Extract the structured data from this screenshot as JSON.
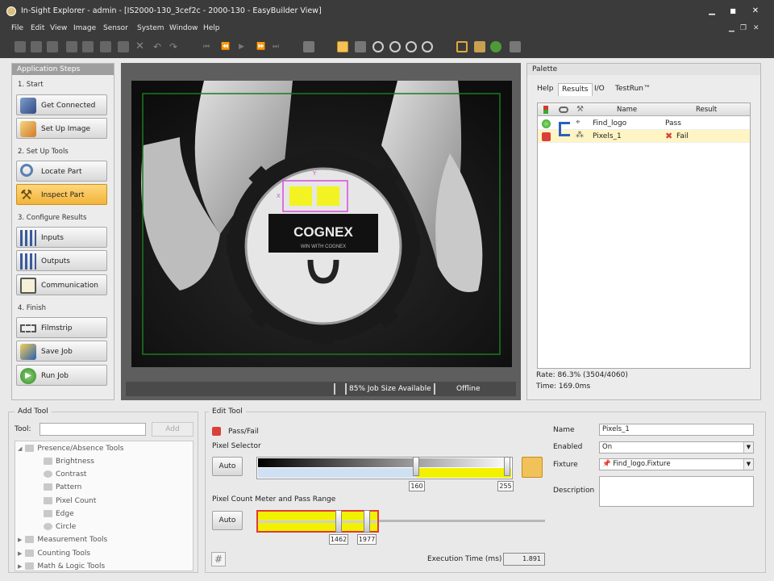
{
  "window": {
    "title": "In-Sight Explorer - admin - [IS2000-130_3cef2c - 2000-130 - EasyBuilder View]",
    "minimize": "▁",
    "maximize": "■",
    "close": "✕",
    "mdi_min": "▁",
    "mdi_restore": "❐",
    "mdi_close": "✕"
  },
  "menu": [
    "File",
    "Edit",
    "View",
    "Image",
    "Sensor",
    "System",
    "Window",
    "Help"
  ],
  "toolbar_icons": [
    "new-icon",
    "open-icon",
    "save-icon",
    "print-icon",
    "copy-icon",
    "paste-icon",
    "delete-icon",
    "undo-icon",
    "redo-icon",
    "first-icon",
    "prev-icon",
    "play-icon",
    "next-icon",
    "last-icon",
    "record-icon",
    "stop-icon",
    "circle-icon",
    "live-icon",
    "acquire-icon",
    "zoom-in-icon",
    "zoom-out-icon",
    "zoom-fit-icon",
    "zoom-100-icon",
    "zoom-active-icon",
    "fixture-icon",
    "graphics-icon",
    "settings-icon",
    "online-icon"
  ],
  "app_steps": {
    "header": "Application Steps",
    "sections": [
      {
        "title": "1. Start",
        "items": [
          {
            "label": "Get Connected",
            "icon": "camera-icon"
          },
          {
            "label": "Set Up Image",
            "icon": "image-setup-icon"
          }
        ]
      },
      {
        "title": "2. Set Up Tools",
        "items": [
          {
            "label": "Locate Part",
            "icon": "magnifier-icon"
          },
          {
            "label": "Inspect Part",
            "icon": "tools-icon",
            "active": true
          }
        ]
      },
      {
        "title": "3. Configure Results",
        "items": [
          {
            "label": "Inputs",
            "icon": "inputs-icon"
          },
          {
            "label": "Outputs",
            "icon": "outputs-icon"
          },
          {
            "label": "Communication",
            "icon": "communication-icon"
          }
        ]
      },
      {
        "title": "4. Finish",
        "items": [
          {
            "label": "Filmstrip",
            "icon": "filmstrip-icon"
          },
          {
            "label": "Save Job",
            "icon": "save-job-icon"
          },
          {
            "label": "Run Job",
            "icon": "run-icon"
          }
        ]
      }
    ]
  },
  "image_view": {
    "status": {
      "job_size": "85% Job Size Available",
      "mode": "Offline"
    },
    "logo_text": "COGNEX",
    "logo_sub": "WIN WITH COGNEX",
    "roi_x": "X",
    "roi_y": "Y"
  },
  "palette": {
    "header": "Palette",
    "tabs": [
      "Help",
      "Results",
      "I/O",
      "TestRun™"
    ],
    "active_tab": "Results",
    "columns": [
      "Name",
      "Result"
    ],
    "rows": [
      {
        "status": "pass",
        "name": "Find_logo",
        "result": "Pass",
        "tool_icon": "pattern-tool-icon"
      },
      {
        "status": "fail",
        "name": "Pixels_1",
        "result": "Fail",
        "tool_icon": "pixel-tool-icon",
        "selected": true
      }
    ],
    "rate": "Rate: 86.3% (3504/4060)",
    "time": "Time: 169.0ms"
  },
  "add_tool": {
    "header": "Add Tool",
    "tool_label": "Tool:",
    "tool_value": "",
    "add_button": "Add",
    "tree": [
      {
        "label": "Presence/Absence Tools",
        "level": 0,
        "expanded": true
      },
      {
        "label": "Brightness",
        "level": 1
      },
      {
        "label": "Contrast",
        "level": 1
      },
      {
        "label": "Pattern",
        "level": 1
      },
      {
        "label": "Pixel Count",
        "level": 1
      },
      {
        "label": "Edge",
        "level": 1
      },
      {
        "label": "Circle",
        "level": 1
      },
      {
        "label": "Measurement Tools",
        "level": 0
      },
      {
        "label": "Counting Tools",
        "level": 0
      },
      {
        "label": "Math & Logic Tools",
        "level": 0
      }
    ]
  },
  "edit_tool": {
    "header": "Edit Tool",
    "pass_fail_label": "Pass/Fail",
    "pass_fail_state": "fail",
    "pixel_selector_label": "Pixel Selector",
    "pixel_auto": "Auto",
    "pixel_low": "160",
    "pixel_high": "255",
    "pixel_max": 255,
    "count_label": "Pixel Count Meter and Pass Range",
    "count_auto": "Auto",
    "count_low": "1462",
    "count_high": "1977",
    "exec_label": "Execution Time (ms)",
    "exec_value": "1.891",
    "props": {
      "name_label": "Name",
      "name": "Pixels_1",
      "enabled_label": "Enabled",
      "enabled": "On",
      "fixture_label": "Fixture",
      "fixture": "Find_logo.Fixture",
      "description_label": "Description",
      "description": ""
    }
  }
}
